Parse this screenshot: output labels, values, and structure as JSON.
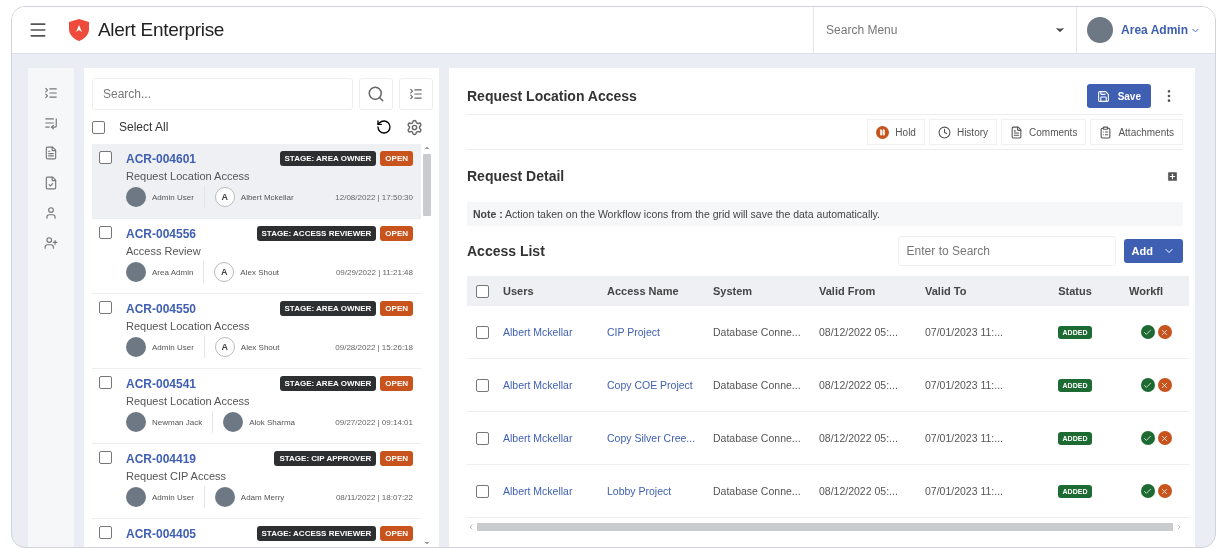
{
  "header": {
    "brand": "Alert Enterprise",
    "search_menu": {
      "placeholder": "Search Menu"
    },
    "user": "Area Admin"
  },
  "list_panel": {
    "search": {
      "placeholder": "Search..."
    },
    "select_all": {
      "label": "Select All",
      "checked": false
    },
    "requests": [
      {
        "id": "ACR-004601",
        "stage": "STAGE: AREA OWNER",
        "status": "OPEN",
        "title": "Request Location Access",
        "requester": {
          "name": "Admin User",
          "kind": "photo"
        },
        "assignee": {
          "name": "Albert Mckellar",
          "kind": "letter",
          "letter": "A"
        },
        "time": "12/08/2022 | 17:50:30",
        "selected": true,
        "checked": false
      },
      {
        "id": "ACR-004556",
        "stage": "STAGE: ACCESS REVIEWER",
        "status": "OPEN",
        "title": "Access Review",
        "requester": {
          "name": "Area Admin",
          "kind": "photo"
        },
        "assignee": {
          "name": "Alex Shout",
          "kind": "letter",
          "letter": "A"
        },
        "time": "09/29/2022 | 11:21:48",
        "selected": false,
        "checked": false
      },
      {
        "id": "ACR-004550",
        "stage": "STAGE: AREA OWNER",
        "status": "OPEN",
        "title": "Request Location Access",
        "requester": {
          "name": "Admin User",
          "kind": "photo"
        },
        "assignee": {
          "name": "Alex Shout",
          "kind": "letter",
          "letter": "A"
        },
        "time": "09/28/2022 | 15:26:18",
        "selected": false,
        "checked": false
      },
      {
        "id": "ACR-004541",
        "stage": "STAGE: AREA OWNER",
        "status": "OPEN",
        "title": "Request Location Access",
        "requester": {
          "name": "Newman Jack",
          "kind": "photo"
        },
        "assignee": {
          "name": "Alok Sharma",
          "kind": "photo"
        },
        "time": "09/27/2022 | 09:14:01",
        "selected": false,
        "checked": false
      },
      {
        "id": "ACR-004419",
        "stage": "STAGE: CIP APPROVER",
        "status": "OPEN",
        "title": "Request CIP Access",
        "requester": {
          "name": "Admin User",
          "kind": "photo"
        },
        "assignee": {
          "name": "Adam Merry",
          "kind": "photo"
        },
        "time": "08/11/2022 | 18:07:22",
        "selected": false,
        "checked": false
      },
      {
        "id": "ACR-004405",
        "stage": "STAGE: ACCESS REVIEWER",
        "status": "OPEN",
        "selected": false,
        "checked": false
      }
    ]
  },
  "detail": {
    "title": "Request Location Access",
    "save": "Save",
    "actions": [
      {
        "label": "Hold",
        "kind": "hold"
      },
      {
        "label": "History",
        "kind": "history"
      },
      {
        "label": "Comments",
        "kind": "comments"
      },
      {
        "label": "Attachments",
        "kind": "attachments"
      }
    ],
    "section_title": "Request Detail",
    "note": "**Note :** Action taken on the Workflow icons from the grid will save the data automatically.",
    "access_list": {
      "title": "Access List",
      "search": {
        "placeholder": "Enter to Search"
      },
      "add": "Add",
      "select_all": {
        "checked": false
      },
      "columns": [
        "Users",
        "Access Name",
        "System",
        "Valid From",
        "Valid To",
        "Status",
        "Workfl"
      ],
      "rows": [
        {
          "user": "Albert Mckellar",
          "access": "CIP Project",
          "system": "Database Conne...",
          "from": "08/12/2022 05:...",
          "to": "07/01/2023 11:...",
          "status": "ADDED",
          "checked": false
        },
        {
          "user": "Albert Mckellar",
          "access": "Copy COE Project",
          "system": "Database Conne...",
          "from": "08/12/2022 05:...",
          "to": "07/01/2023 11:...",
          "status": "ADDED",
          "checked": false
        },
        {
          "user": "Albert Mckellar",
          "access": "Copy Silver Cree...",
          "system": "Database Conne...",
          "from": "08/12/2022 05:...",
          "to": "07/01/2023 11:...",
          "status": "ADDED",
          "checked": false
        },
        {
          "user": "Albert Mckellar",
          "access": "Lobby Project",
          "system": "Database Conne...",
          "from": "08/12/2022 05:...",
          "to": "07/01/2023 11:...",
          "status": "ADDED",
          "checked": false
        }
      ]
    }
  }
}
